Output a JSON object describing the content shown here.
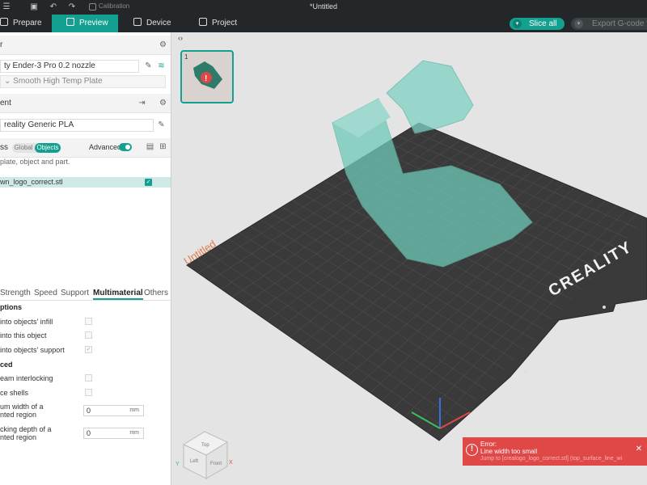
{
  "titlebar": {
    "calibration_label": "Calibration",
    "window_title": "*Untitled"
  },
  "nav": {
    "tabs": [
      {
        "label": "Prepare",
        "active": false
      },
      {
        "label": "Preview",
        "active": true
      },
      {
        "label": "Device",
        "active": false
      },
      {
        "label": "Project",
        "active": false
      }
    ],
    "slice_label": "Slice all",
    "export_label": "Export G-code fi"
  },
  "sidebar": {
    "printer": {
      "header_label": "r",
      "name": "ty Ender-3 Pro 0.2 nozzle",
      "plate": "Smooth High Temp Plate"
    },
    "filament": {
      "header_label": "ent",
      "name": "reality Generic PLA"
    },
    "process": {
      "header_label": "ss",
      "seg_global": "Global",
      "seg_objects": "Objects",
      "advanced_label": "Advanced",
      "hint": "plate, object and part.",
      "object_name": "wn_logo_correct.stl"
    },
    "subtabs": [
      {
        "label": "Strength",
        "active": false
      },
      {
        "label": "Speed",
        "active": false
      },
      {
        "label": "Support",
        "active": false
      },
      {
        "label": "Multimaterial",
        "active": true
      },
      {
        "label": "Others",
        "active": false
      }
    ],
    "options_group": {
      "title": "ptions",
      "items": [
        {
          "label": "into objects' infill",
          "checked": false
        },
        {
          "label": "into this object",
          "checked": false
        },
        {
          "label": "into objects' support",
          "checked": true
        }
      ]
    },
    "advanced_group": {
      "title": "ced",
      "items": [
        {
          "label": "eam interlocking",
          "checked": false
        },
        {
          "label": "ce shells",
          "checked": false
        }
      ],
      "fields": [
        {
          "label_1": "um width of a",
          "label_2": "nted region",
          "value": "0",
          "unit": "mm"
        },
        {
          "label_1": "cking depth of a",
          "label_2": "nted region",
          "value": "0",
          "unit": "mm"
        }
      ]
    }
  },
  "viewport": {
    "plate_number": "1",
    "plate_label": "Untitled",
    "bed_brand": "CREALITY",
    "cube_faces": {
      "top": "Top",
      "left": "Left",
      "front": "Front"
    },
    "axis_labels": {
      "x": "X",
      "y": "Y"
    },
    "colors": {
      "accent": "#14a090",
      "model": "#6fc9b9",
      "bed": "#3a3a3a",
      "error": "#e04848"
    }
  },
  "toast": {
    "title": "Error:",
    "message": "Line width too small",
    "detail": "Jump to [crealogo_logo_correct.stl] (top_surface_line_wi"
  }
}
